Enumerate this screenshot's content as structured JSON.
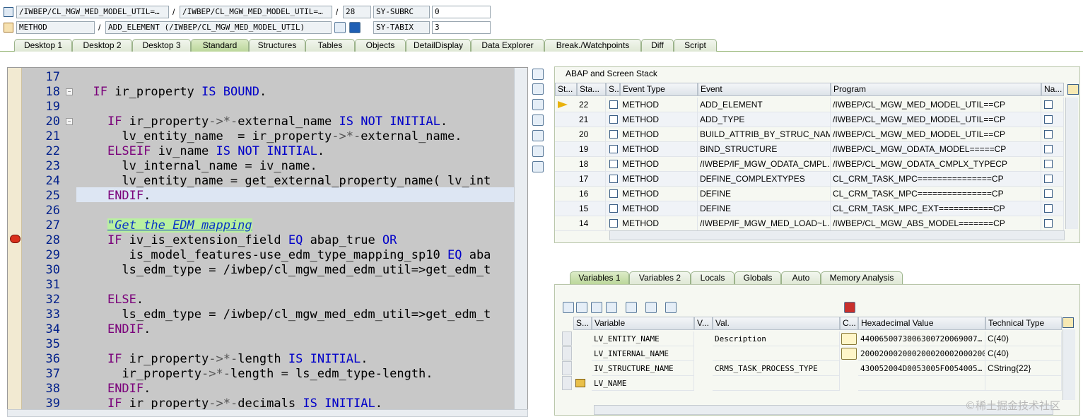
{
  "header": {
    "row1": {
      "program": "/IWBEP/CL_MGW_MED_MODEL_UTIL=…",
      "sep1": "/",
      "include": "/IWBEP/CL_MGW_MED_MODEL_UTIL=…",
      "sep2": "/",
      "line": "28",
      "sysvar_name": "SY-SUBRC",
      "sysvar_value": "0"
    },
    "row2": {
      "event_type": "METHOD",
      "sep1": "/",
      "event": "ADD_ELEMENT (/IWBEP/CL_MGW_MED_MODEL_UTIL)",
      "sysvar_name": "SY-TABIX",
      "sysvar_value": "3"
    }
  },
  "tabs": [
    "Desktop 1",
    "Desktop 2",
    "Desktop 3",
    "Standard",
    "Structures",
    "Tables",
    "Objects",
    "DetailDisplay",
    "Data Explorer",
    "Break./Watchpoints",
    "Diff",
    "Script"
  ],
  "active_tab": "Standard",
  "editor": {
    "lines": [
      {
        "n": "17",
        "code": ""
      },
      {
        "n": "18",
        "code": "  IF ir_property IS BOUND."
      },
      {
        "n": "19",
        "code": ""
      },
      {
        "n": "20",
        "code": "    IF ir_property->*-external_name IS NOT INITIAL."
      },
      {
        "n": "21",
        "code": "      lv_entity_name  = ir_property->*-external_name."
      },
      {
        "n": "22",
        "code": "    ELSEIF iv_name IS NOT INITIAL."
      },
      {
        "n": "23",
        "code": "      lv_internal_name = iv_name."
      },
      {
        "n": "24",
        "code": "      lv_entity_name = get_external_property_name( lv_int"
      },
      {
        "n": "25",
        "code": "    ENDIF."
      },
      {
        "n": "26",
        "code": ""
      },
      {
        "n": "27",
        "code": "    \"Get the EDM mapping"
      },
      {
        "n": "28",
        "code": "    IF iv_is_extension_field EQ abap_true OR"
      },
      {
        "n": "29",
        "code": "       is_model_features-use_edm_type_mapping_sp10 EQ aba"
      },
      {
        "n": "30",
        "code": "      ls_edm_type = /iwbep/cl_mgw_med_edm_util=>get_edm_t"
      },
      {
        "n": "31",
        "code": ""
      },
      {
        "n": "32",
        "code": "    ELSE."
      },
      {
        "n": "33",
        "code": "      ls_edm_type = /iwbep/cl_mgw_med_edm_util=>get_edm_t"
      },
      {
        "n": "34",
        "code": "    ENDIF."
      },
      {
        "n": "35",
        "code": ""
      },
      {
        "n": "36",
        "code": "    IF ir_property->*-length IS INITIAL."
      },
      {
        "n": "37",
        "code": "      ir_property->*-length = ls_edm_type-length."
      },
      {
        "n": "38",
        "code": "    ENDIF."
      },
      {
        "n": "39",
        "code": "    IF ir_property->*-decimals IS INITIAL."
      }
    ]
  },
  "stack": {
    "title": "ABAP and Screen Stack",
    "columns": [
      "St...",
      "Sta...",
      "S...",
      "Event Type",
      "Event",
      "Program",
      "Na..."
    ],
    "rows": [
      {
        "sta": "22",
        "type": "METHOD",
        "event": "ADD_ELEMENT",
        "program": "/IWBEP/CL_MGW_MED_MODEL_UTIL==CP"
      },
      {
        "sta": "21",
        "type": "METHOD",
        "event": "ADD_TYPE",
        "program": "/IWBEP/CL_MGW_MED_MODEL_UTIL==CP"
      },
      {
        "sta": "20",
        "type": "METHOD",
        "event": "BUILD_ATTRIB_BY_STRUC_NAM…",
        "program": "/IWBEP/CL_MGW_MED_MODEL_UTIL==CP"
      },
      {
        "sta": "19",
        "type": "METHOD",
        "event": "BIND_STRUCTURE",
        "program": "/IWBEP/CL_MGW_ODATA_MODEL=====CP"
      },
      {
        "sta": "18",
        "type": "METHOD",
        "event": "/IWBEP/IF_MGW_ODATA_CMPL…",
        "program": "/IWBEP/CL_MGW_ODATA_CMPLX_TYPECP"
      },
      {
        "sta": "17",
        "type": "METHOD",
        "event": "DEFINE_COMPLEXTYPES",
        "program": "CL_CRM_TASK_MPC===============CP"
      },
      {
        "sta": "16",
        "type": "METHOD",
        "event": "DEFINE",
        "program": "CL_CRM_TASK_MPC===============CP"
      },
      {
        "sta": "15",
        "type": "METHOD",
        "event": "DEFINE",
        "program": "CL_CRM_TASK_MPC_EXT===========CP"
      },
      {
        "sta": "14",
        "type": "METHOD",
        "event": "/IWBEP/IF_MGW_MED_LOAD~L…",
        "program": "/IWBEP/CL_MGW_ABS_MODEL=======CP"
      }
    ]
  },
  "var_tabs": [
    "Variables 1",
    "Variables 2",
    "Locals",
    "Globals",
    "Auto",
    "Memory Analysis"
  ],
  "active_var_tab": "Variables 1",
  "variables": {
    "columns": [
      "S...",
      "Variable",
      "V...",
      "Val.",
      "C...",
      "Hexadecimal Value",
      "Technical Type"
    ],
    "rows": [
      {
        "name": "LV_ENTITY_NAME",
        "val": "Description",
        "hex": "4400650073006300720069007…",
        "type": "C(40)"
      },
      {
        "name": "LV_INTERNAL_NAME",
        "val": "",
        "hex": "2000200020002000200020002000…",
        "type": "C(40)"
      },
      {
        "name": "IV_STRUCTURE_NAME",
        "val": "CRMS_TASK_PROCESS_TYPE",
        "hex": "430052004D0053005F0054005…",
        "type": "CString{22}"
      },
      {
        "name": "LV_NAME",
        "val": "",
        "hex": "",
        "type": ""
      }
    ]
  },
  "watermark": "©稀土掘金技术社区",
  "colors": {
    "tab_active": "#bcd79b",
    "tab_border": "#9bb38a",
    "editor_bg": "#c8c8c8",
    "keyword": "#0000c8",
    "comment_bg": "#b9f0a0",
    "line_number": "#001f8a"
  }
}
